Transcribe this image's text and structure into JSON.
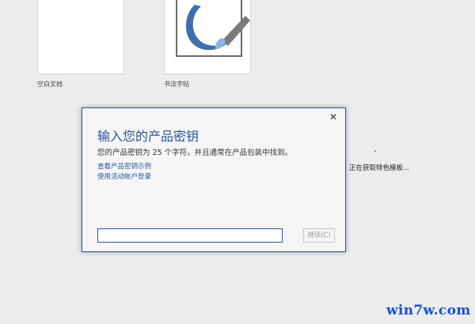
{
  "templates": [
    {
      "label": "空白文档"
    },
    {
      "label": "书法字帖"
    }
  ],
  "loading": {
    "text": "正在获取特色模板..."
  },
  "dialog": {
    "close": "✕",
    "title": "输入您的产品密钥",
    "description": "您的产品密钥为 25 个字符，并且通常在产品包装中找到。",
    "links": {
      "example": "查看产品密钥示例",
      "account": "使用活动帐户登录"
    },
    "input_value": "",
    "continue_label": "继续(C)"
  },
  "watermark": "win7w.com"
}
